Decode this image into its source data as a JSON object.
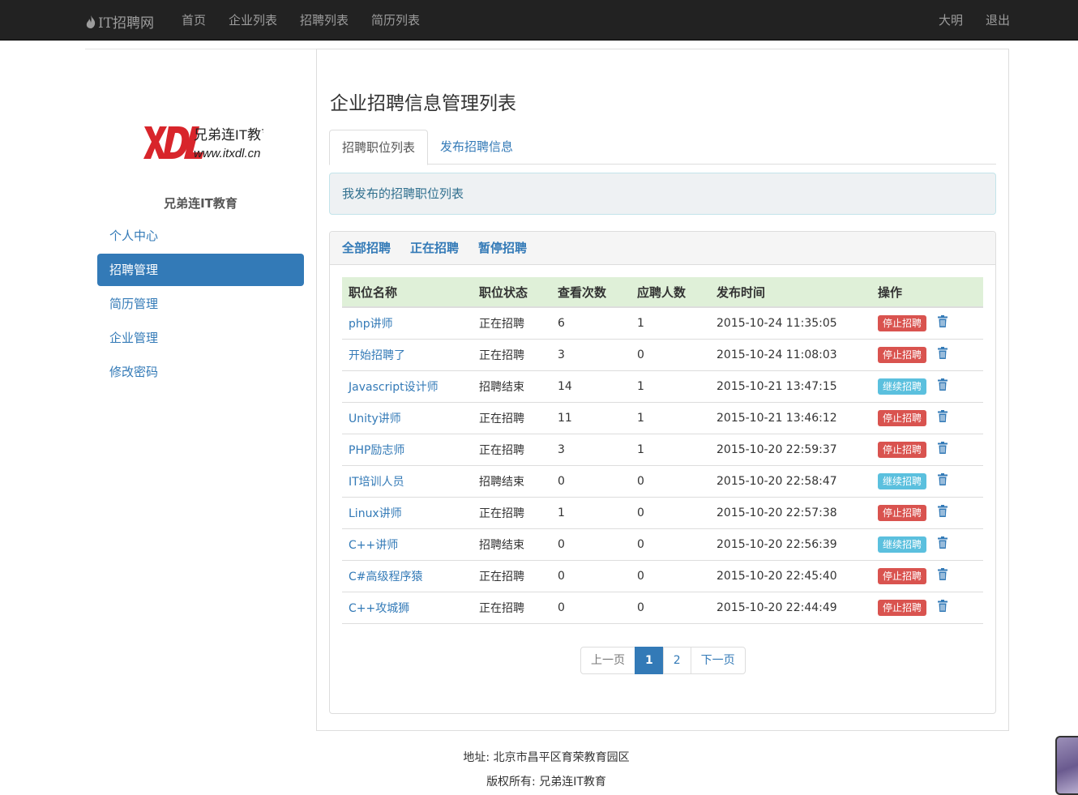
{
  "navbar": {
    "brand": "IT招聘网",
    "links": [
      "首页",
      "企业列表",
      "招聘列表",
      "简历列表"
    ],
    "user": "大明",
    "logout": "退出"
  },
  "sidebar": {
    "logo_text": "兄弟连IT教育",
    "logo_url": "www.itxdl.cn",
    "company_name": "兄弟连IT教育",
    "items": [
      {
        "label": "个人中心"
      },
      {
        "label": "招聘管理"
      },
      {
        "label": "简历管理"
      },
      {
        "label": "企业管理"
      },
      {
        "label": "修改密码"
      }
    ]
  },
  "main": {
    "title": "企业招聘信息管理列表",
    "tabs": [
      {
        "label": "招聘职位列表"
      },
      {
        "label": "发布招聘信息"
      }
    ],
    "info": "我发布的招聘职位列表",
    "filters": [
      "全部招聘",
      "正在招聘",
      "暂停招聘"
    ],
    "table": {
      "headers": [
        "职位名称",
        "职位状态",
        "查看次数",
        "应聘人数",
        "发布时间",
        "操作"
      ],
      "rows": [
        {
          "title": "php讲师",
          "status": "正在招聘",
          "views": "6",
          "applicants": "1",
          "time": "2015-10-24 11:35:05",
          "action": "停止招聘"
        },
        {
          "title": "开始招聘了",
          "status": "正在招聘",
          "views": "3",
          "applicants": "0",
          "time": "2015-10-24 11:08:03",
          "action": "停止招聘"
        },
        {
          "title": "Javascript设计师",
          "status": "招聘结束",
          "views": "14",
          "applicants": "1",
          "time": "2015-10-21 13:47:15",
          "action": "继续招聘"
        },
        {
          "title": "Unity讲师",
          "status": "正在招聘",
          "views": "11",
          "applicants": "1",
          "time": "2015-10-21 13:46:12",
          "action": "停止招聘"
        },
        {
          "title": "PHP励志师",
          "status": "正在招聘",
          "views": "3",
          "applicants": "1",
          "time": "2015-10-20 22:59:37",
          "action": "停止招聘"
        },
        {
          "title": "IT培训人员",
          "status": "招聘结束",
          "views": "0",
          "applicants": "0",
          "time": "2015-10-20 22:58:47",
          "action": "继续招聘"
        },
        {
          "title": "Linux讲师",
          "status": "正在招聘",
          "views": "1",
          "applicants": "0",
          "time": "2015-10-20 22:57:38",
          "action": "停止招聘"
        },
        {
          "title": "C++讲师",
          "status": "招聘结束",
          "views": "0",
          "applicants": "0",
          "time": "2015-10-20 22:56:39",
          "action": "继续招聘"
        },
        {
          "title": "C#高级程序猿",
          "status": "正在招聘",
          "views": "0",
          "applicants": "0",
          "time": "2015-10-20 22:45:40",
          "action": "停止招聘"
        },
        {
          "title": "C++攻城狮",
          "status": "正在招聘",
          "views": "0",
          "applicants": "0",
          "time": "2015-10-20 22:44:49",
          "action": "停止招聘"
        }
      ]
    },
    "pagination": {
      "prev": "上一页",
      "pages": [
        "1",
        "2"
      ],
      "current": "1",
      "next": "下一页"
    }
  },
  "footer": {
    "address": "地址: 北京市昌平区育荣教育园区",
    "copyright": "版权所有: 兄弟连IT教育"
  },
  "colors": {
    "primary": "#337ab7",
    "stop": "#d9534f",
    "resume": "#5bc0de",
    "navbar": "#222222",
    "header_row": "#dff0d8"
  }
}
